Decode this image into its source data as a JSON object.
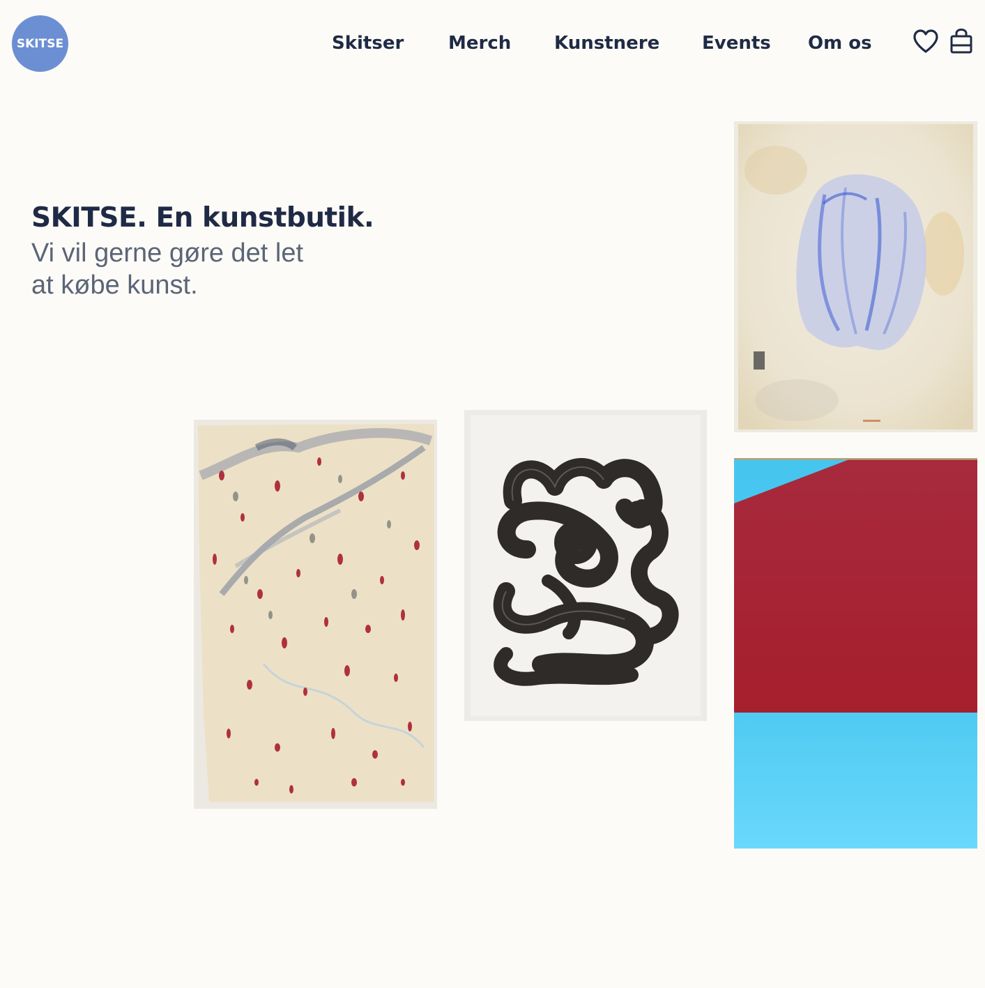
{
  "header": {
    "logo_text": "SKITSE",
    "nav": [
      {
        "label": "Skitser"
      },
      {
        "label": "Merch"
      },
      {
        "label": "Kunstnere"
      },
      {
        "label": "Events"
      },
      {
        "label": "Om os"
      }
    ],
    "icons": [
      "heart-icon",
      "shopping-bag-icon"
    ]
  },
  "hero": {
    "title": "SKITSE. En kunstbutik.",
    "subtitle_line1": "Vi vil gerne gøre det let",
    "subtitle_line2": "at købe kunst."
  },
  "artworks": [
    {
      "name": "artwork-blue-shell-watercolor"
    },
    {
      "name": "artwork-red-splatter-painting"
    },
    {
      "name": "artwork-black-brushstroke-loops"
    },
    {
      "name": "artwork-red-blue-color-field"
    }
  ],
  "colors": {
    "background": "#fdfbf7",
    "text_primary": "#1f2b45",
    "text_secondary": "#5b6578",
    "logo_circle": "#6b8fd2"
  }
}
